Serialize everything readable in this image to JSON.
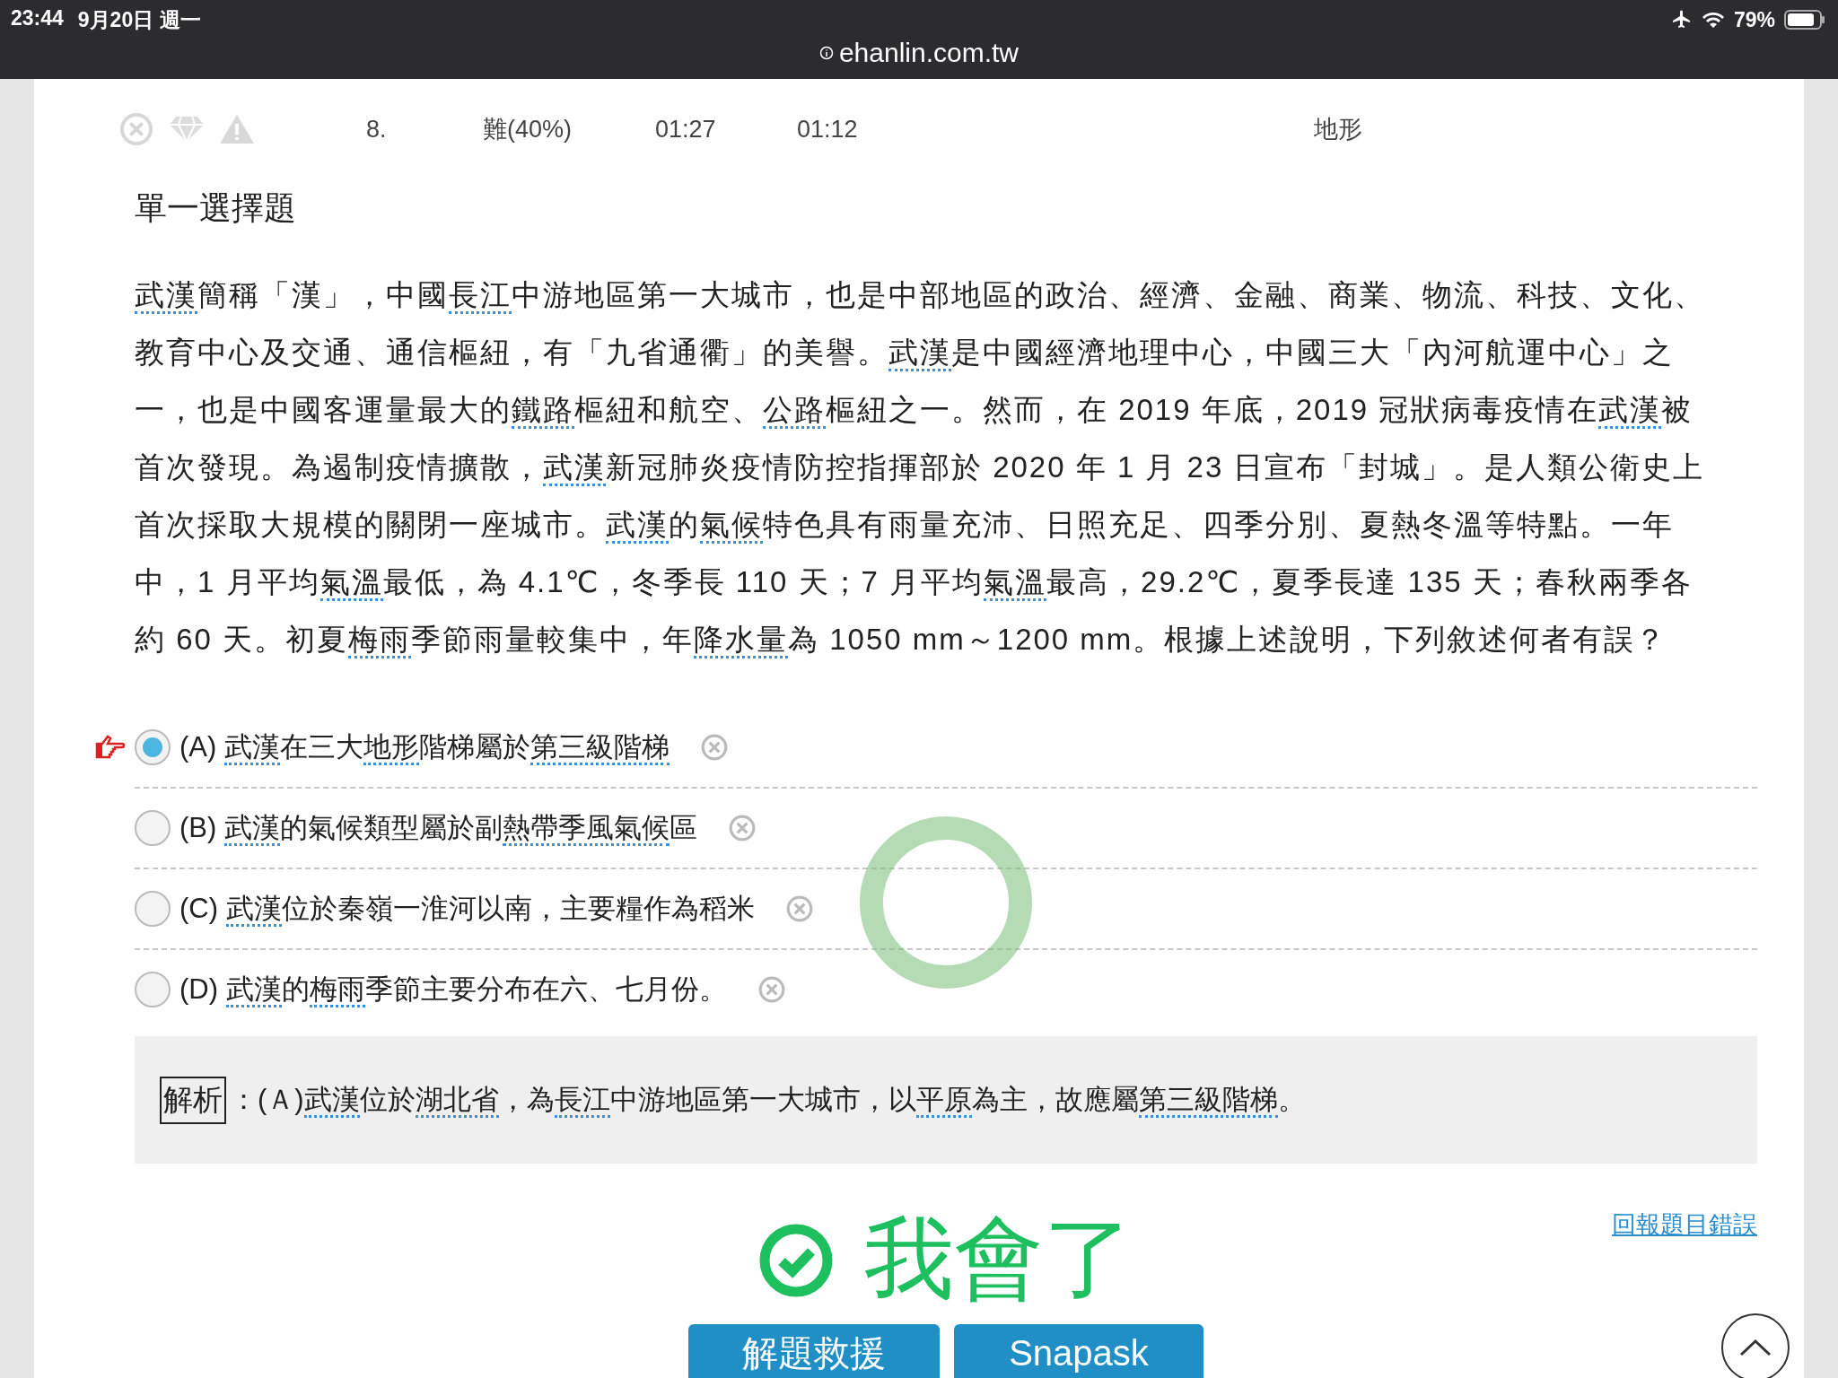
{
  "status_bar": {
    "time": "23:44",
    "date": "9月20日 週一",
    "battery": "79%",
    "url": "ehanlin.com.tw"
  },
  "question_info": {
    "number": "8.",
    "difficulty": "難(40%)",
    "time_1": "01:27",
    "time_2": "01:12",
    "topic": "地形"
  },
  "question_type": "單一選擇題",
  "passage": [
    {
      "text": "武漢",
      "linked": true
    },
    {
      "text": "簡稱「漢」，中國",
      "linked": false
    },
    {
      "text": "長江",
      "linked": true
    },
    {
      "text": "中游地區第一大城市，也是中部地區的政治、經濟、金融、商業、物流、科技、文化、教育中心及交通、通信樞紐，有「九省通衢」的美譽。",
      "linked": false
    },
    {
      "text": "武漢",
      "linked": true
    },
    {
      "text": "是中國經濟地理中心，中國三大「內河航運中心」之一，也是中國客運量最大的",
      "linked": false
    },
    {
      "text": "鐵路",
      "linked": true
    },
    {
      "text": "樞紐和航空、",
      "linked": false
    },
    {
      "text": "公路",
      "linked": true
    },
    {
      "text": "樞紐之一。然而，在 2019 年底，2019 冠狀病毒疫情在",
      "linked": false
    },
    {
      "text": "武漢",
      "linked": true
    },
    {
      "text": "被首次發現。為遏制疫情擴散，",
      "linked": false
    },
    {
      "text": "武漢",
      "linked": true
    },
    {
      "text": "新冠肺炎疫情防控指揮部於 2020 年 1 月 23 日宣布「封城」。是人類公衛史上首次採取大規模的關閉一座城市。",
      "linked": false
    },
    {
      "text": "武漢",
      "linked": true
    },
    {
      "text": "的",
      "linked": false
    },
    {
      "text": "氣候",
      "linked": true
    },
    {
      "text": "特色具有雨量充沛、日照充足、四季分別、夏熱冬溫等特點。一年中，1 月平均",
      "linked": false
    },
    {
      "text": "氣溫",
      "linked": true
    },
    {
      "text": "最低，為 4.1℃，冬季長 110 天；7 月平均",
      "linked": false
    },
    {
      "text": "氣溫",
      "linked": true
    },
    {
      "text": "最高，29.2℃，夏季長達 135 天；春秋兩季各約 60 天。初夏",
      "linked": false
    },
    {
      "text": "梅雨",
      "linked": true
    },
    {
      "text": "季節雨量較集中，年",
      "linked": false
    },
    {
      "text": "降水量",
      "linked": true
    },
    {
      "text": "為 1050 mm～1200 mm。根據上述說明，下列敘述何者有誤？",
      "linked": false
    }
  ],
  "options": [
    {
      "letter": "(A)",
      "selected": true,
      "parts": [
        {
          "text": "武漢",
          "linked": true
        },
        {
          "text": "在三大",
          "linked": false
        },
        {
          "text": "地形",
          "linked": true
        },
        {
          "text": "階梯屬於",
          "linked": false
        },
        {
          "text": "第三級階梯",
          "linked": true
        }
      ]
    },
    {
      "letter": "(B)",
      "selected": false,
      "parts": [
        {
          "text": "武漢",
          "linked": true
        },
        {
          "text": "的氣候類型屬於副",
          "linked": false
        },
        {
          "text": "熱帶季風氣候",
          "linked": true
        },
        {
          "text": "區",
          "linked": false
        }
      ]
    },
    {
      "letter": "(C)",
      "selected": false,
      "parts": [
        {
          "text": "武漢",
          "linked": true
        },
        {
          "text": "位於秦嶺一淮河以南，主要糧作為稻米",
          "linked": false
        }
      ]
    },
    {
      "letter": "(D)",
      "selected": false,
      "parts": [
        {
          "text": "武漢",
          "linked": true
        },
        {
          "text": "的",
          "linked": false
        },
        {
          "text": "梅雨",
          "linked": true
        },
        {
          "text": "季節主要分布在六、七月份。",
          "linked": false
        }
      ]
    }
  ],
  "explanation": {
    "label": "解析",
    "parts": [
      {
        "text": "：(Ａ)",
        "linked": false
      },
      {
        "text": "武漢",
        "linked": true
      },
      {
        "text": "位於",
        "linked": false
      },
      {
        "text": "湖北省",
        "linked": true
      },
      {
        "text": "，為",
        "linked": false
      },
      {
        "text": "長江",
        "linked": true
      },
      {
        "text": "中游地區第一大城市，以",
        "linked": false
      },
      {
        "text": "平原",
        "linked": true
      },
      {
        "text": "為主，故應屬",
        "linked": false
      },
      {
        "text": "第三級階梯",
        "linked": true
      },
      {
        "text": "。",
        "linked": false
      }
    ]
  },
  "report_link": "回報題目錯誤",
  "understood_button": "我會了",
  "buttons": [
    "解題救援",
    "Snapask"
  ]
}
